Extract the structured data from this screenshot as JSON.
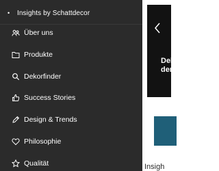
{
  "sidebar": {
    "top_link": {
      "bullet": "•",
      "label": "Insights by Schattdecor"
    },
    "items": [
      {
        "icon": "people-icon",
        "label": "Über uns"
      },
      {
        "icon": "folder-icon",
        "label": "Produkte"
      },
      {
        "icon": "search-icon",
        "label": "Dekorfinder"
      },
      {
        "icon": "thumbs-up-icon",
        "label": "Success Stories"
      },
      {
        "icon": "pencil-icon",
        "label": "Design & Trends"
      },
      {
        "icon": "heart-icon",
        "label": "Philosophie"
      },
      {
        "icon": "star-icon",
        "label": "Qualität"
      }
    ]
  },
  "content": {
    "hero": {
      "line1": "Del",
      "line2": "der"
    },
    "title": "Insigh"
  },
  "colors": {
    "sidebar_bg": "#2b2b2b",
    "hero_bg": "#121212",
    "teaser_bg": "#1f5f78",
    "text_light": "#ffffff"
  }
}
